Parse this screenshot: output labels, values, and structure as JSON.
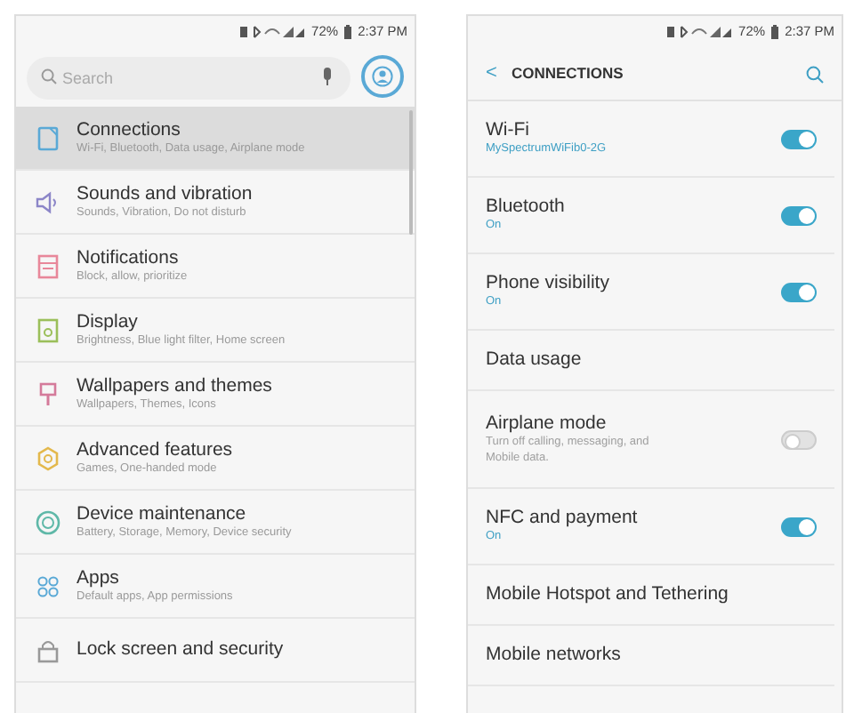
{
  "left_screen": {
    "status_bar": {
      "battery": "72%",
      "time": "2:37 PM"
    },
    "search": {
      "placeholder": "Search"
    },
    "items": [
      {
        "title": "Connections",
        "subtitle": "Wi-Fi, Bluetooth, Data usage, Airplane mode",
        "color": "#5aa9d6",
        "selected": true
      },
      {
        "title": "Sounds and vibration",
        "subtitle": "Sounds, Vibration, Do not disturb",
        "color": "#8c86c8",
        "selected": false
      },
      {
        "title": "Notifications",
        "subtitle": "Block, allow, prioritize",
        "color": "#e8879a",
        "selected": false
      },
      {
        "title": "Display",
        "subtitle": "Brightness, Blue light filter, Home screen",
        "color": "#9bbf5a",
        "selected": false
      },
      {
        "title": "Wallpapers and themes",
        "subtitle": "Wallpapers, Themes, Icons",
        "color": "#d47a9a",
        "selected": false
      },
      {
        "title": "Advanced features",
        "subtitle": "Games, One-handed mode",
        "color": "#e3b84c",
        "selected": false
      },
      {
        "title": "Device maintenance",
        "subtitle": "Battery, Storage, Memory, Device security",
        "color": "#5fb8a8",
        "selected": false
      },
      {
        "title": "Apps",
        "subtitle": "Default apps, App permissions",
        "color": "#5aa9d6",
        "selected": false
      },
      {
        "title": "Lock screen and security",
        "selected": false
      }
    ]
  },
  "right_screen": {
    "status_bar": {
      "battery": "72%",
      "time": "2:37 PM"
    },
    "header": {
      "back": "<",
      "title": "CONNECTIONS"
    },
    "items": [
      {
        "title": "Wi-Fi",
        "subtitle": "MySpectrumWiFib0-2G",
        "kind": "toggle",
        "on": true
      },
      {
        "title": "Bluetooth",
        "subtitle": "On",
        "kind": "toggle",
        "on": true
      },
      {
        "title": "Phone visibility",
        "subtitle": "On",
        "kind": "toggle",
        "on": true
      },
      {
        "title": "Data usage",
        "kind": "plain"
      },
      {
        "title": "Airplane mode",
        "subtitle": "Turn off calling, messaging, and Mobile data.",
        "kind": "toggle",
        "on": false
      },
      {
        "title": "NFC and payment",
        "subtitle": "On",
        "kind": "toggle",
        "on": true
      },
      {
        "title": "Mobile Hotspot and Tethering",
        "kind": "plain"
      },
      {
        "title": "Mobile networks",
        "kind": "plain"
      }
    ]
  }
}
